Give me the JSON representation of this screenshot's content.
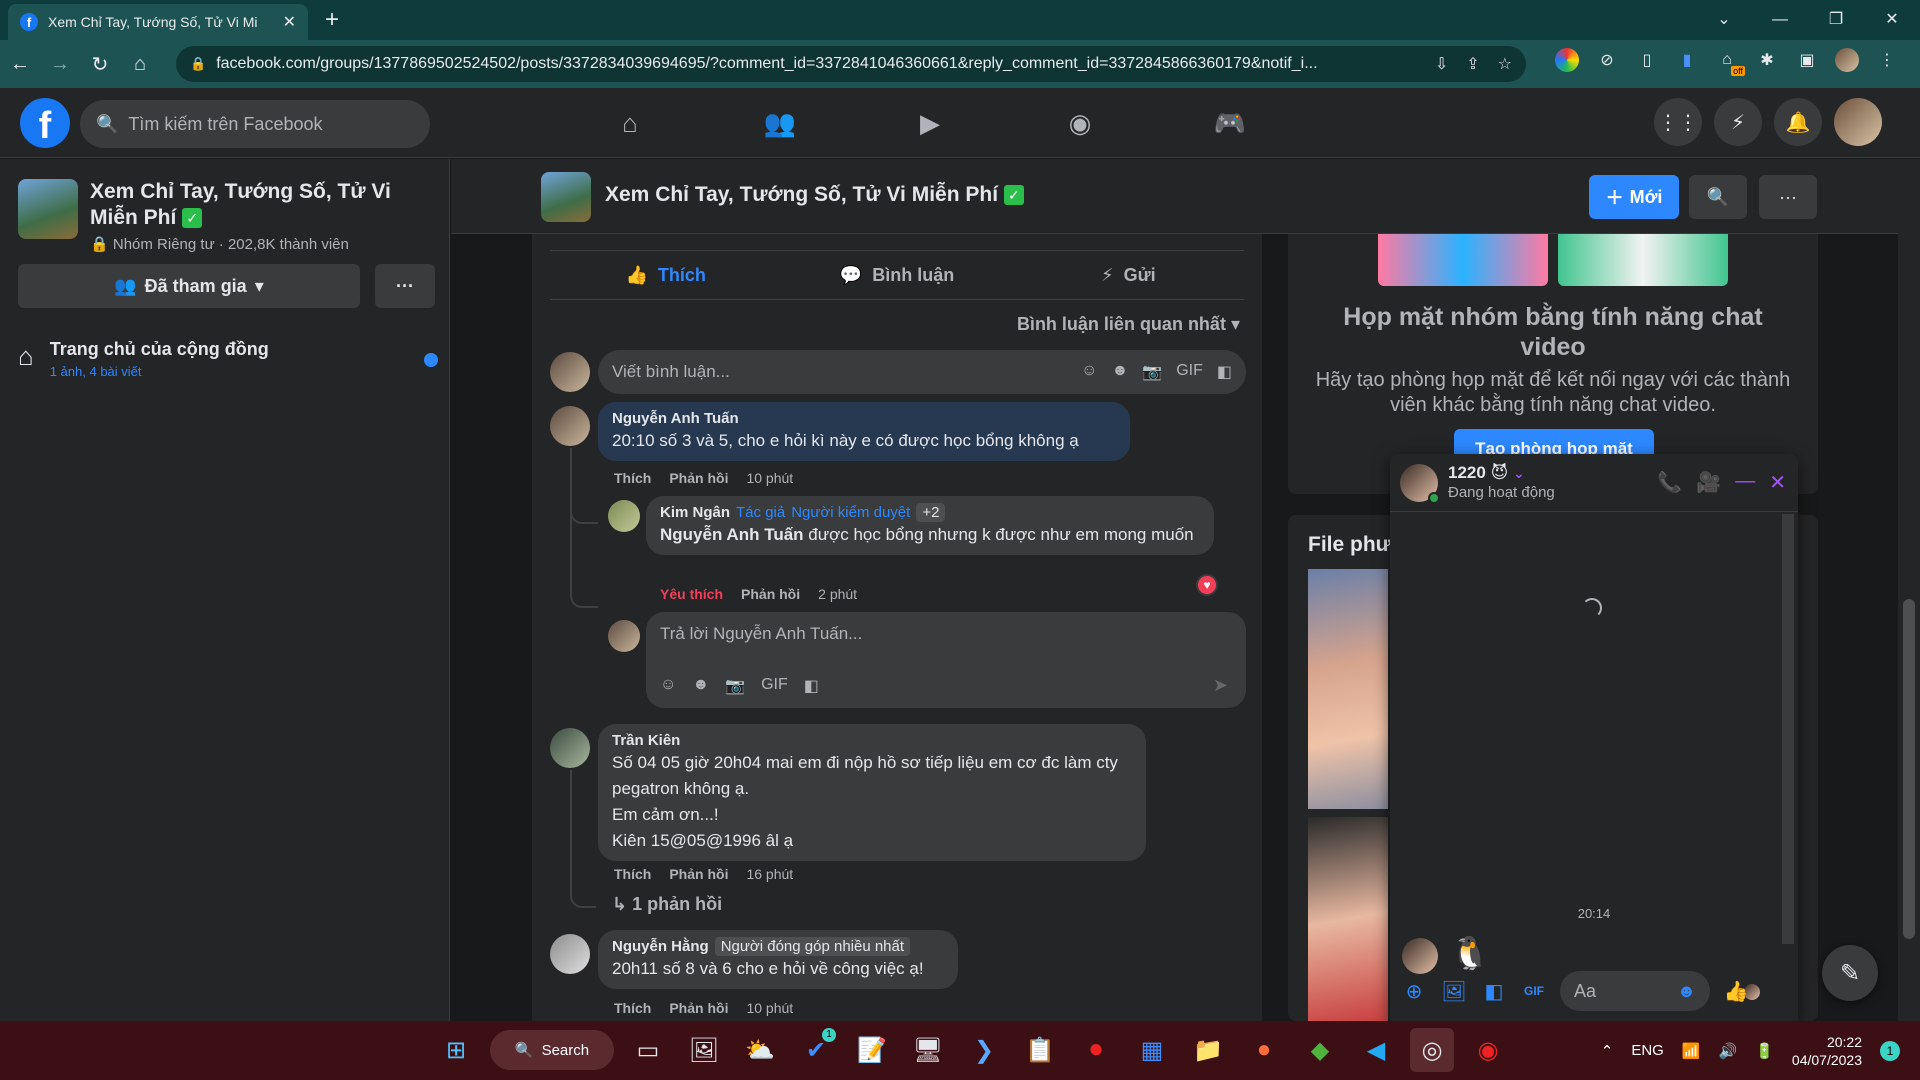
{
  "browser": {
    "tab_title": "Xem Chỉ Tay, Tướng Số, Tử Vi Mi",
    "url": "facebook.com/groups/1377869502524502/posts/3372834039694695/?comment_id=3372841046360661&reply_comment_id=3372845866360179&notif_i...",
    "ext_badge": "off"
  },
  "fb": {
    "search_placeholder": "Tìm kiếm trên Facebook",
    "logo": "f"
  },
  "group": {
    "name": "Xem Chỉ Tay, Tướng Số, Tử Vi Miễn Phí",
    "meta": "Nhóm Riêng tư · 202,8K thành viên",
    "joined_label": "Đã tham gia",
    "more_label": "···",
    "community_title": "Trang chủ của cộng đồng",
    "community_sub": "1 ảnh, 4 bài viết",
    "new_label": "Mới"
  },
  "post": {
    "like": "Thích",
    "comment": "Bình luận",
    "send": "Gửi",
    "sort": "Bình luận liên quan nhất",
    "write_placeholder": "Viết bình luận...",
    "comments": [
      {
        "name": "Nguyễn Anh Tuấn",
        "text": "20:10 số 3 và 5, cho e hỏi kì này e có được học bổng không ạ",
        "like": "Thích",
        "reply": "Phản hồi",
        "time": "10 phút"
      },
      {
        "name": "Kim Ngân",
        "badge1": "Tác giả",
        "badge2": "Người kiểm duyệt",
        "badge3": "+2",
        "mention": "Nguyễn Anh Tuấn",
        "text": " được học bổng nhưng k được như em mong muốn",
        "like": "Yêu thích",
        "reply": "Phản hồi",
        "time": "2 phút"
      },
      {
        "name": "Trần Kiên",
        "line1": "Số 04 05 giờ 20h04 mai em đi nộp hồ sơ tiếp liệu em cơ đc làm cty",
        "line2": "pegatron không ạ.",
        "line3": "Em cảm ơn...!",
        "line4": "Kiên 15@05@1996 âl ạ",
        "like": "Thích",
        "reply": "Phản hồi",
        "time": "16 phút",
        "replies": "1 phản hồi"
      },
      {
        "name": "Nguyễn Hằng",
        "badge": "Người đóng góp nhiều nhất",
        "text": "20h11 số 8 và 6 cho e hỏi về công việc ạ!",
        "like": "Thích",
        "reply": "Phản hồi",
        "time": "10 phút"
      }
    ],
    "reply_placeholder": "Trả lời Nguyễn Anh Tuấn..."
  },
  "right": {
    "title": "Họp mặt nhóm bằng tính năng chat video",
    "desc": "Hãy tạo phòng họp mặt để kết nối ngay với các thành viên khác bằng tính năng chat video.",
    "button": "Tạo phòng họp mặt",
    "files_title": "File phươ"
  },
  "chat": {
    "name": "1220",
    "status": "Đang hoạt động",
    "time": "20:14",
    "input_placeholder": "Aa"
  },
  "taskbar": {
    "search": "Search",
    "lang": "ENG",
    "time": "20:22",
    "date": "04/07/2023",
    "notif": "1",
    "badge": "1"
  }
}
